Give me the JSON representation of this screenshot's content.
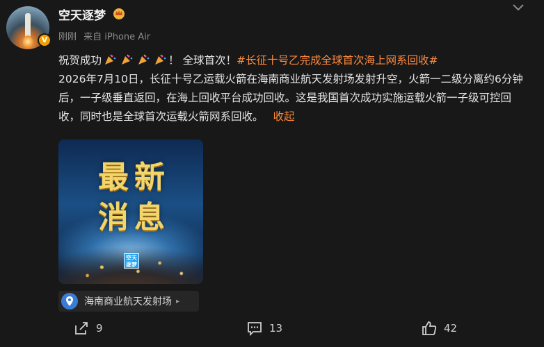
{
  "post": {
    "username": "空天逐梦",
    "verified_badge": "V",
    "time": "刚刚",
    "source": "来自 iPhone Air",
    "text_intro": "祝贺成功",
    "text_after_emoji": "！ 全球首次！",
    "hashtag": "#长征十号乙完成全球首次海上网系回收#",
    "body": "2026年7月10日，长征十号乙运载火箭在海南商业航天发射场发射升空，火箭一二级分离约6分钟后，一子级垂直返回，在海上回收平台成功回收。这是我国首次成功实施运载火箭一子级可控回收，同时也是全球首次运载火箭网系回收。",
    "collapse_label": "收起",
    "emoji_icons": [
      "party-popper-icon",
      "party-popper-icon",
      "party-popper-icon",
      "party-popper-icon"
    ]
  },
  "image": {
    "headline_line1": "最新",
    "headline_line2": "消息",
    "logo_text_line1": "空天",
    "logo_text_line2": "逐梦"
  },
  "location": {
    "label": "海南商业航天发射场"
  },
  "actions": {
    "share_count": "9",
    "comment_count": "13",
    "like_count": "42"
  },
  "colors": {
    "accent": "#ff8a3d",
    "background": "#181818",
    "badge": "#f2a000"
  }
}
